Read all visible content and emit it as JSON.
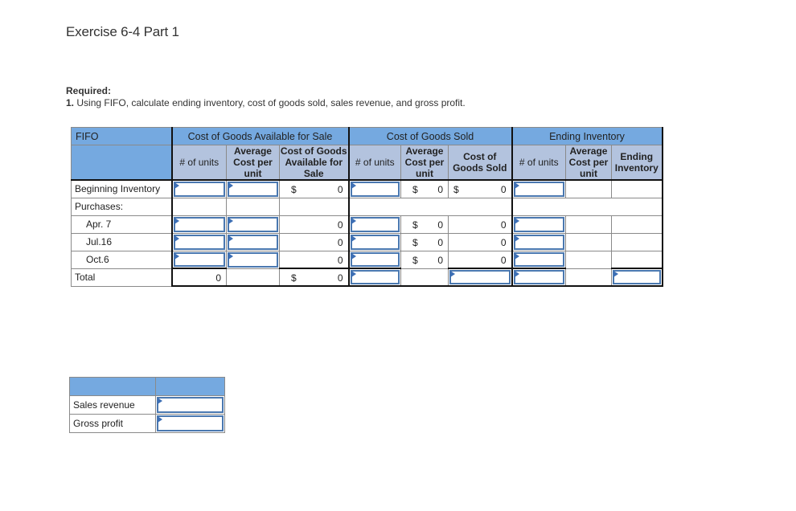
{
  "page": {
    "title": "Exercise 6-4 Part 1",
    "required_label": "Required:",
    "required_number": "1.",
    "required_text": "Using FIFO, calculate ending inventory, cost of goods sold, sales revenue, and gross profit."
  },
  "table": {
    "corner_label": "FIFO",
    "groups": {
      "cgas": "Cost of Goods Available for Sale",
      "cogs": "Cost of Goods Sold",
      "ei": "Ending Inventory"
    },
    "columns": {
      "cgas_units": "# of units",
      "cgas_avg": "Average Cost per unit",
      "cgas_total": "Cost of Goods Available for Sale",
      "cogs_units": "# of units",
      "cogs_avg": "Average Cost per unit",
      "cogs_total": "Cost of Goods Sold",
      "ei_units": "# of units",
      "ei_avg": "Average Cost per unit",
      "ei_total": "Ending Inventory"
    },
    "rows": {
      "beginning": {
        "label": "Beginning Inventory",
        "cgas_total_currency": "$",
        "cgas_total": "0",
        "cogs_avg_currency": "$",
        "cogs_avg": "0",
        "cogs_total_currency": "$",
        "cogs_total": "0"
      },
      "purchases": {
        "label": "Purchases:"
      },
      "apr7": {
        "label": "Apr. 7",
        "cgas_total": "0",
        "cogs_avg_currency": "$",
        "cogs_avg": "0",
        "cogs_total": "0"
      },
      "jul16": {
        "label": "Jul.16",
        "cgas_total": "0",
        "cogs_avg_currency": "$",
        "cogs_avg": "0",
        "cogs_total": "0"
      },
      "oct6": {
        "label": "Oct.6",
        "cgas_total": "0",
        "cogs_avg_currency": "$",
        "cogs_avg": "0",
        "cogs_total": "0"
      },
      "total": {
        "label": "Total",
        "cgas_units": "0",
        "cgas_total_currency": "$",
        "cgas_total": "0"
      }
    }
  },
  "summary": {
    "rows": [
      {
        "label": "Sales revenue",
        "value": ""
      },
      {
        "label": "Gross profit",
        "value": ""
      }
    ]
  }
}
